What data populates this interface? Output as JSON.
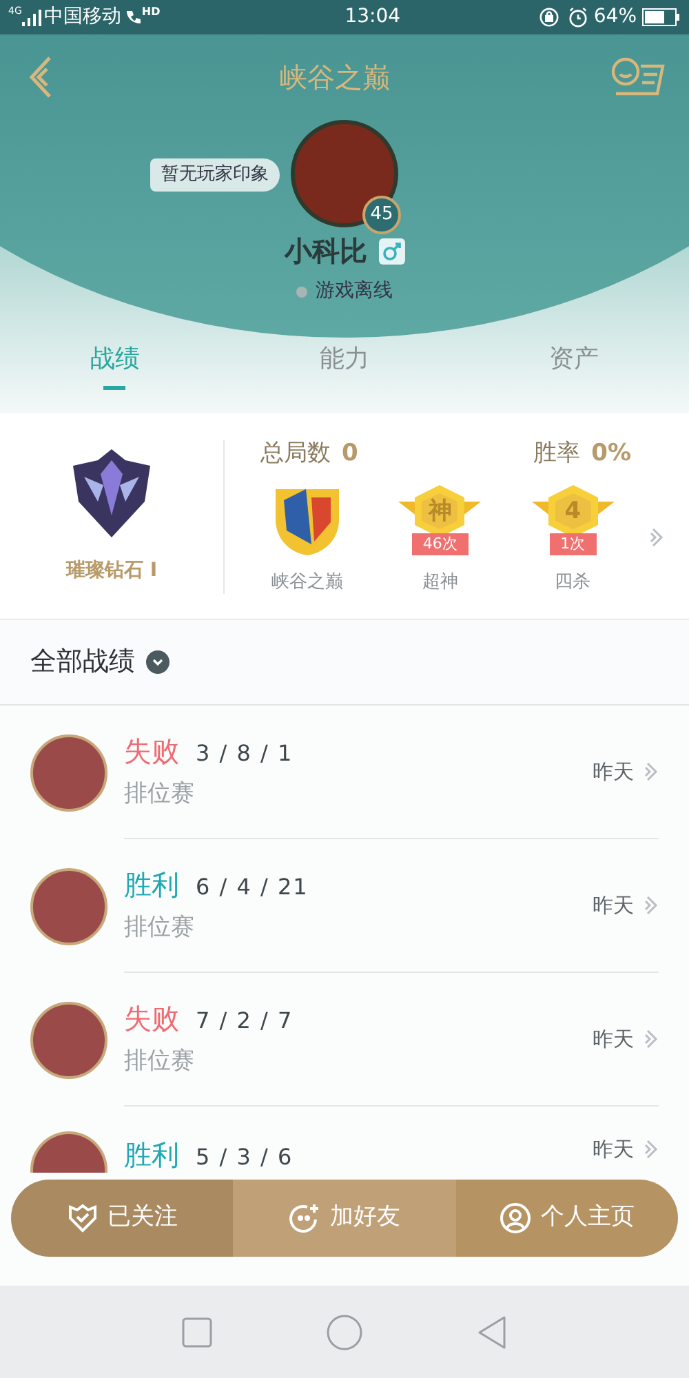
{
  "status_bar": {
    "network": "4G",
    "carrier": "中国移动",
    "hd": "HD",
    "time": "13:04",
    "battery": "64%"
  },
  "header": {
    "title": "峡谷之巅",
    "impression": "暂无玩家印象",
    "level": "45",
    "name": "小科比",
    "status": "游戏离线"
  },
  "tabs": [
    {
      "label": "战绩",
      "selected": true
    },
    {
      "label": "能力",
      "selected": false
    },
    {
      "label": "资产",
      "selected": false
    }
  ],
  "summary": {
    "rank": "璀璨钻石 I",
    "total_label": "总局数",
    "total": "0",
    "winrate_label": "胜率",
    "winrate": "0%",
    "badges": [
      {
        "kind": "emblem",
        "label": "峡谷之巅"
      },
      {
        "kind": "medal",
        "glyph": "神",
        "count": "46次",
        "label": "超神"
      },
      {
        "kind": "medal",
        "glyph": "4",
        "count": "1次",
        "label": "四杀"
      }
    ]
  },
  "filter": "全部战绩",
  "matches": [
    {
      "result": "失败",
      "win": false,
      "kda": "3 / 8 / 1",
      "mode": "排位赛",
      "time": "昨天"
    },
    {
      "result": "胜利",
      "win": true,
      "kda": "6 / 4 / 21",
      "mode": "排位赛",
      "time": "昨天"
    },
    {
      "result": "失败",
      "win": false,
      "kda": "7 / 2 / 7",
      "mode": "排位赛",
      "time": "昨天"
    },
    {
      "result": "胜利",
      "win": true,
      "kda": "5 / 3 / 6",
      "time": "昨天"
    }
  ],
  "actions": [
    {
      "kind": "followed",
      "label": "已关注"
    },
    {
      "kind": "add",
      "label": "加好友"
    },
    {
      "kind": "profile",
      "label": "个人主页"
    }
  ]
}
